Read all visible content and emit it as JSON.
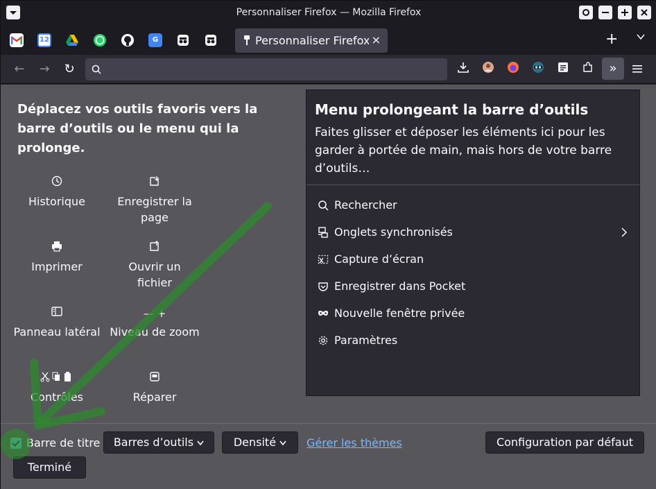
{
  "window": {
    "title": "Personnaliser Firefox — Mozilla Firefox",
    "buttons": [
      "settings",
      "minimize",
      "maximize",
      "close"
    ]
  },
  "tabs": {
    "pinned_icons": [
      "gmail-icon",
      "calendar-icon",
      "google-drive-icon",
      "whatsapp-icon",
      "github-icon",
      "translate-icon",
      "incognito-icon",
      "incognito-icon"
    ],
    "calendar_day": "12",
    "active_label": "Personnaliser Firefox",
    "close_glyph": "×",
    "new_tab_glyph": "+",
    "list_glyph": "⌄"
  },
  "navbar": {
    "back_glyph": "←",
    "forward_glyph": "→",
    "reload_glyph": "↻",
    "url_value": "",
    "overflow_glyph": "»"
  },
  "customize": {
    "heading": "Déplacez vos outils favoris vers la barre d’outils ou le menu qui la prolonge.",
    "palette": [
      {
        "label": "Historique",
        "icon": "history-icon"
      },
      {
        "label": "Enregistrer la page",
        "icon": "save-page-icon"
      },
      {
        "label": "Imprimer",
        "icon": "print-icon"
      },
      {
        "label": "Ouvrir un fichier",
        "icon": "open-file-icon"
      },
      {
        "label": "Panneau latéral",
        "icon": "sidebar-icon"
      },
      {
        "label": "Niveau de zoom",
        "icon": "zoom-icon"
      },
      {
        "label": "Contrôles",
        "icon": "edit-controls-icon"
      },
      {
        "label": "Réparer",
        "icon": "repair-text-encoding-icon"
      }
    ],
    "zoom_glyph": "— +"
  },
  "overflow_panel": {
    "title": "Menu prolongeant la barre d’outils",
    "description": "Faites glisser et déposer les éléments ici pour les garder à portée de main, mais hors de votre barre d’outils…",
    "items": [
      {
        "label": "Rechercher",
        "icon": "search-icon"
      },
      {
        "label": "Onglets synchronisés",
        "icon": "synced-tabs-icon",
        "has_submenu": true
      },
      {
        "label": "Capture d’écran",
        "icon": "screenshot-icon"
      },
      {
        "label": "Enregistrer dans Pocket",
        "icon": "pocket-icon"
      },
      {
        "label": "Nouvelle fenêtre privée",
        "icon": "private-window-icon"
      },
      {
        "label": "Paramètres",
        "icon": "gear-icon"
      }
    ]
  },
  "footer": {
    "titlebar_checkbox_label": "Barre de titre",
    "titlebar_checked": true,
    "toolbars_button": "Barres d’outils",
    "density_button": "Densité",
    "themes_link": "Gérer les thèmes",
    "restore_defaults_button": "Configuration par défaut",
    "done_button": "Terminé"
  },
  "colors": {
    "accent_checkbox": "#5ec9d9",
    "link": "#7ab8ff",
    "annotation_arrow": "#2e8b2e"
  }
}
